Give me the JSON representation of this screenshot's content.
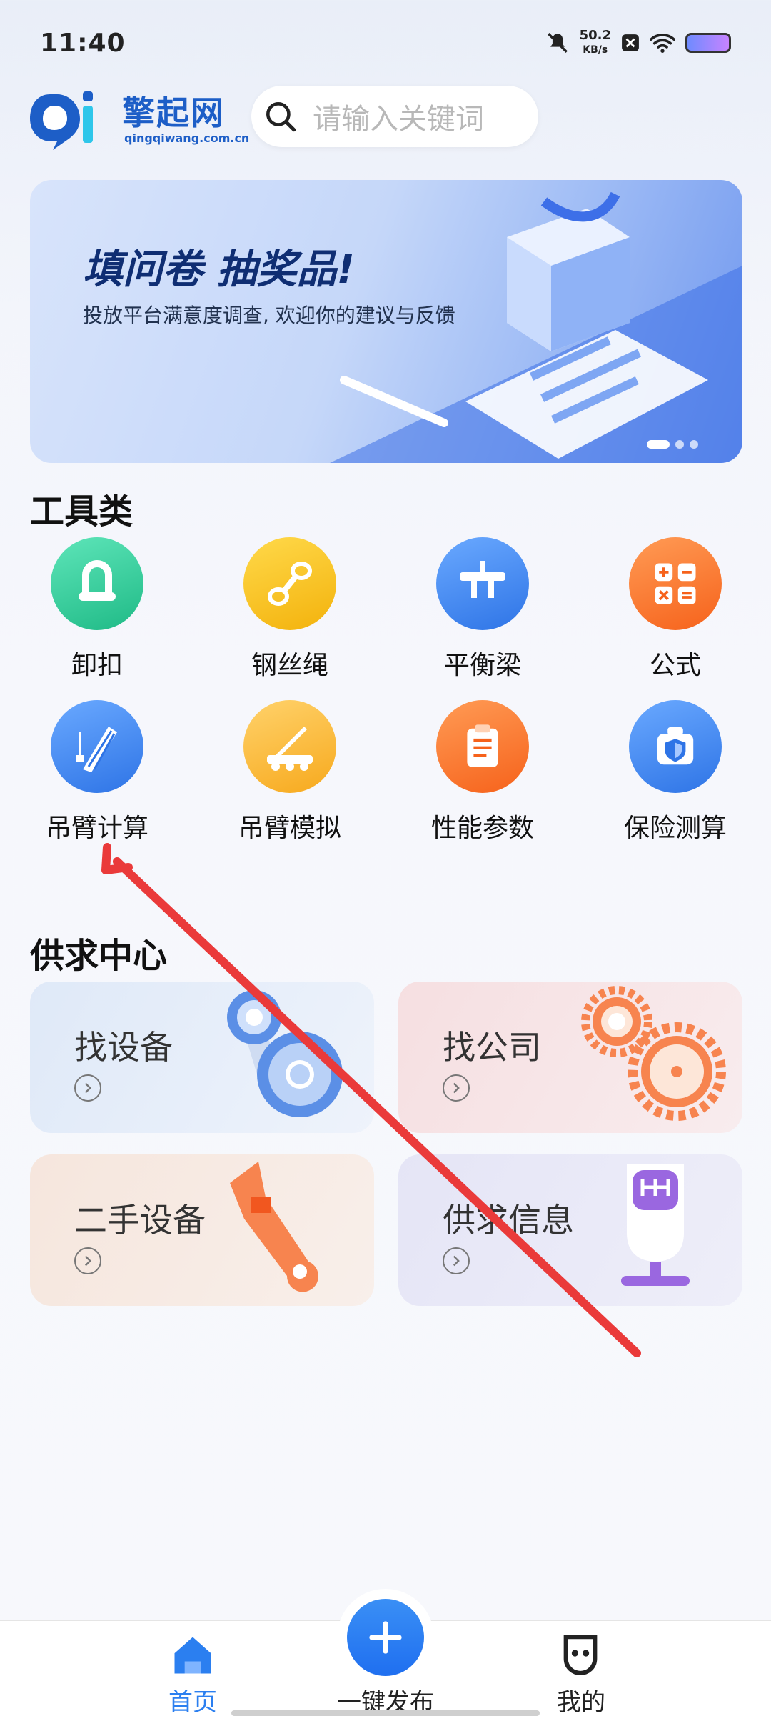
{
  "status_bar": {
    "time": "11:40",
    "net_speed_value": "50.2",
    "net_speed_unit": "KB/s",
    "icons": [
      "mute-bell-icon",
      "close-box-icon",
      "wifi-icon",
      "battery-icon"
    ]
  },
  "header": {
    "logo_cn": "擎起网",
    "logo_en": "qingqiwang.com.cn",
    "search_placeholder": "请输入关键词"
  },
  "banner": {
    "title": "填问卷 抽奖品!",
    "subtitle": "投放平台满意度调查, 欢迎你的建议与反馈",
    "page_count": 3,
    "active_page": 1
  },
  "tools": {
    "title": "工具类",
    "items": [
      {
        "label": "卸扣",
        "icon": "shackle-icon",
        "color": "#2fcf9d"
      },
      {
        "label": "钢丝绳",
        "icon": "wire-rope-icon",
        "color": "#f5c21b"
      },
      {
        "label": "平衡梁",
        "icon": "balance-beam-icon",
        "color": "#3a85ee"
      },
      {
        "label": "公式",
        "icon": "calculator-icon",
        "color": "#f9752c"
      },
      {
        "label": "吊臂计算",
        "icon": "crane-boom-icon",
        "color": "#3a85ee"
      },
      {
        "label": "吊臂模拟",
        "icon": "crane-truck-icon",
        "color": "#f8b92a"
      },
      {
        "label": "性能参数",
        "icon": "clipboard-icon",
        "color": "#f9752c"
      },
      {
        "label": "保险测算",
        "icon": "insurance-shield-icon",
        "color": "#3a85ee"
      }
    ]
  },
  "supply": {
    "title": "供求中心",
    "cards": [
      {
        "label": "找设备",
        "icon": "pulley-icon"
      },
      {
        "label": "找公司",
        "icon": "gears-icon"
      },
      {
        "label": "二手设备",
        "icon": "wrench-icon"
      },
      {
        "label": "供求信息",
        "icon": "gear-shift-icon"
      }
    ]
  },
  "bottom_nav": {
    "home": "首页",
    "publish": "一键发布",
    "mine": "我的"
  }
}
